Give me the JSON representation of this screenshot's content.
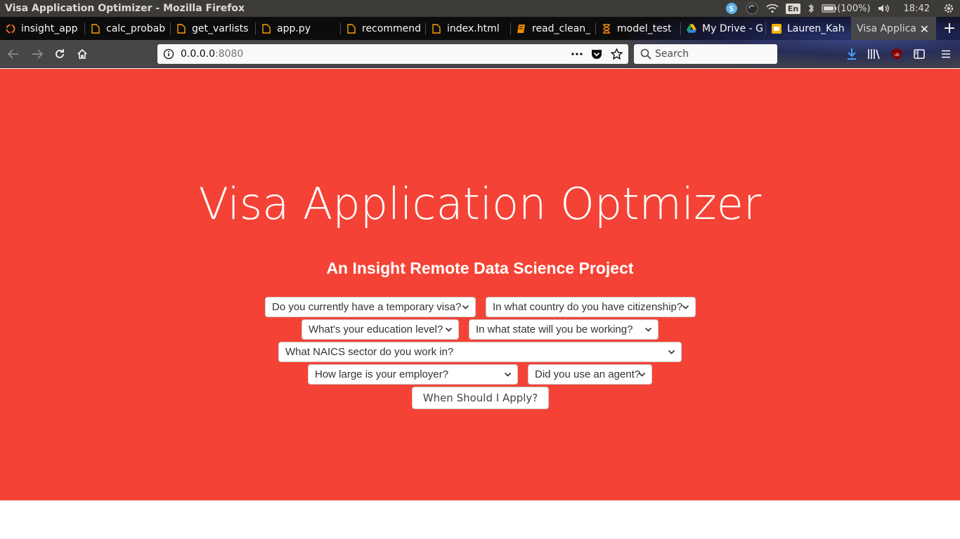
{
  "window": {
    "title": "Visa Application Optimizer - Mozilla Firefox"
  },
  "system_tray": {
    "language": "En",
    "battery": "(100%)",
    "clock": "18:42"
  },
  "tabs": [
    {
      "label": "insight_app",
      "icon": "ubuntu-icon"
    },
    {
      "label": "calc_probab",
      "icon": "file-icon"
    },
    {
      "label": "get_varlists",
      "icon": "file-icon"
    },
    {
      "label": "app.py",
      "icon": "file-icon"
    },
    {
      "label": "recommend",
      "icon": "file-icon"
    },
    {
      "label": "index.html",
      "icon": "file-icon"
    },
    {
      "label": "read_clean_",
      "icon": "notebook-icon"
    },
    {
      "label": "model_test",
      "icon": "hourglass-icon"
    },
    {
      "label": "My Drive - G",
      "icon": "google-drive-icon"
    },
    {
      "label": "Lauren_Kah",
      "icon": "slides-icon"
    },
    {
      "label": "Visa Applica",
      "icon": "none",
      "active": true
    }
  ],
  "navigation": {
    "url_host": "0.0.0.0",
    "url_port": ":8080",
    "search_placeholder": "Search"
  },
  "page": {
    "title": "Visa Application Optmizer",
    "subtitle": "An Insight Remote Data Science Project",
    "selects": {
      "temporary_visa": "Do you currently have a temporary visa?",
      "citizenship": "In what country do you have citizenship?",
      "education": "What's your education level?",
      "work_state": "In what state will you be working?",
      "naics_sector": "What NAICS sector do you work in?",
      "employer_size": "How large is your employer?",
      "agent": "Did you use an agent?"
    },
    "apply_button": "When Should I Apply?"
  },
  "colors": {
    "page_background": "#f44336",
    "tab_strip": "#0c0c0d",
    "toolbar": "#474749",
    "download_accent": "#45a1ff",
    "ublock_red": "#800000"
  }
}
